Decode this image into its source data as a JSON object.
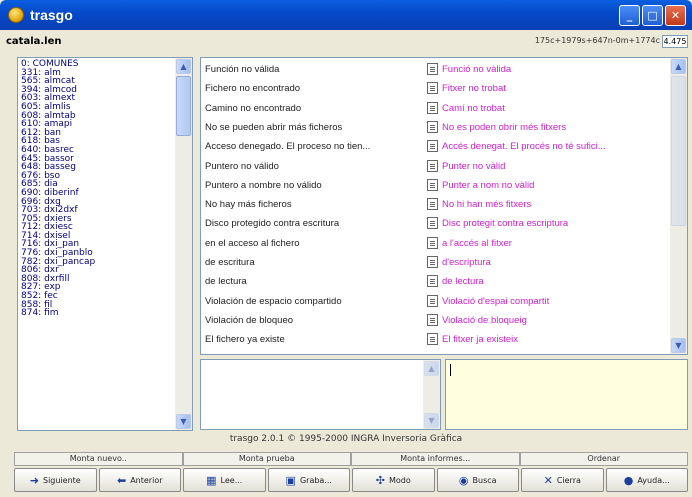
{
  "window": {
    "title": "trasgo",
    "min": "_",
    "max": "□",
    "close": "✕"
  },
  "file": {
    "name": "catala.len",
    "counts": "175c+1979s+647n-0m+1774c",
    "box": "4.475"
  },
  "left_list": [
    "0: COMUNES",
    "331: alm",
    "565: almcat",
    "394: almcod",
    "603: almext",
    "605: almlis",
    "608: almtab",
    "610: amapi",
    "612: ban",
    "618: bas",
    "640: basrec",
    "645: bassor",
    "648: basseg",
    "676: bso",
    "685: dia",
    "690: diberinf",
    "696: dxg",
    "703: dxi2dxf",
    "705: dxiers",
    "712: dxiesc",
    "714: dxisel",
    "716: dxi_pan",
    "776: dxi_panblo",
    "782: dxi_pancap",
    "806: dxr",
    "808: dxrfill",
    "827: exp",
    "852: fec",
    "858: fil",
    "874: fim"
  ],
  "rows": [
    {
      "src": "Función no válida",
      "dst": "Funció no vàlida"
    },
    {
      "src": "Fichero no encontrado",
      "dst": "Fitxer no trobat"
    },
    {
      "src": "Camino no encontrado",
      "dst": "Camí no trobat"
    },
    {
      "src": "No se pueden abrir más ficheros",
      "dst": "No es poden obrir més fitxers"
    },
    {
      "src": "Acceso denegado. El proceso no tien...",
      "dst": "Accés denegat. El procés no té sufici..."
    },
    {
      "src": "Puntero no válido",
      "dst": "Punter no vàlid"
    },
    {
      "src": "Puntero a nombre no válido",
      "dst": "Punter a nom no vàlid"
    },
    {
      "src": "No hay más ficheros",
      "dst": "No hi han més fitxers"
    },
    {
      "src": "Disco protegido contra escritura",
      "dst": "Disc protegit contra escriptura"
    },
    {
      "src": "en el acceso al fichero",
      "dst": "a l'accés al fitxer"
    },
    {
      "src": "de escritura",
      "dst": "d'escriptura"
    },
    {
      "src": "de lectura",
      "dst": "de lectura"
    },
    {
      "src": "Violación de espacio compartido",
      "dst": "Violació d'espai compartit"
    },
    {
      "src": "Violación de bloqueo",
      "dst": "Violació de bloqueig"
    },
    {
      "src": "El fichero ya existe",
      "dst": "El fitxer ja existeix"
    }
  ],
  "status": "trasgo 2.0.1  © 1995-2000  INGRA Inversoria Gràfica",
  "tabs": [
    "Monta nuevo..",
    "Monta prueba",
    "Monta informes...",
    "Ordenar"
  ],
  "buttons": [
    {
      "label": "Siguiente",
      "icon": "arrow-right-icon",
      "glyph": "➜"
    },
    {
      "label": "Anterior",
      "icon": "arrow-left-icon",
      "glyph": "⬅"
    },
    {
      "label": "Lee...",
      "icon": "read-icon",
      "glyph": "▦"
    },
    {
      "label": "Graba...",
      "icon": "save-icon",
      "glyph": "▣"
    },
    {
      "label": "Modo",
      "icon": "mode-icon",
      "glyph": "✣"
    },
    {
      "label": "Busca",
      "icon": "binoculars-icon",
      "glyph": "◉"
    },
    {
      "label": "Cierra",
      "icon": "close-x-icon",
      "glyph": "✕"
    },
    {
      "label": "Ayuda...",
      "icon": "help-icon",
      "glyph": "●"
    }
  ]
}
